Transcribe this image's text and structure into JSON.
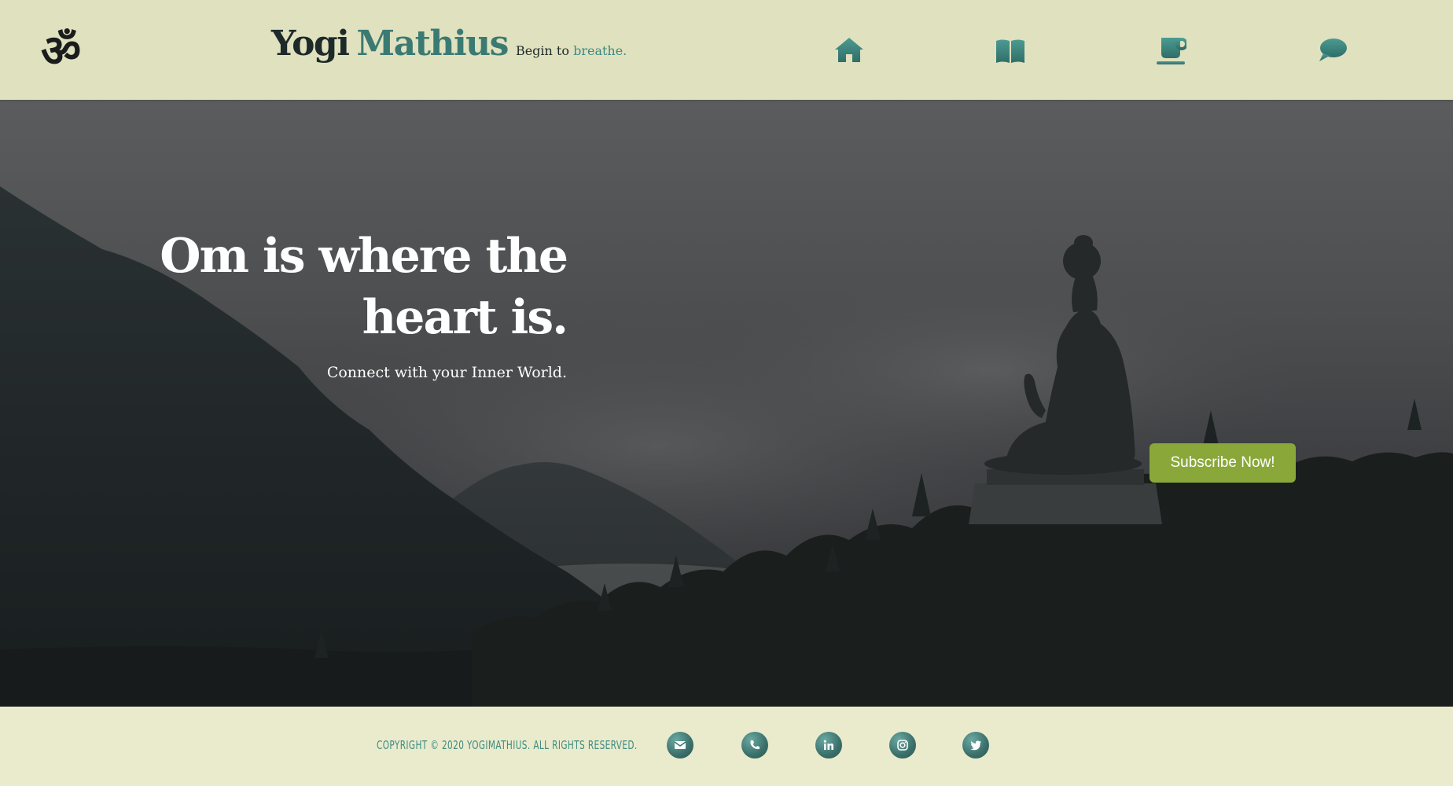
{
  "header": {
    "logo_icon": "om-symbol-icon",
    "brand_first": "Yogi",
    "brand_last": "Mathius",
    "tagline_prefix": "Begin to",
    "tagline_accent": "breathe.",
    "nav": [
      {
        "icon": "home-icon"
      },
      {
        "icon": "book-icon"
      },
      {
        "icon": "coffee-cup-icon"
      },
      {
        "icon": "chat-bubble-icon"
      }
    ]
  },
  "hero": {
    "headline": "Om is where the heart is.",
    "subline": "Connect with your Inner World.",
    "subscribe_label": "Subscribe Now!"
  },
  "footer": {
    "copyright": "Copyright © 2020 YogiMathius. All rights reserved.",
    "social": [
      {
        "icon": "envelope-icon"
      },
      {
        "icon": "phone-icon"
      },
      {
        "icon": "linkedin-icon"
      },
      {
        "icon": "instagram-icon"
      },
      {
        "icon": "twitter-icon"
      }
    ]
  },
  "colors": {
    "header_bg": "#e0e1bf",
    "footer_bg": "#e9ebcc",
    "accent_teal": "#3a7a73",
    "button_green": "#8aa83a",
    "text_dark": "#1e2a2a"
  }
}
